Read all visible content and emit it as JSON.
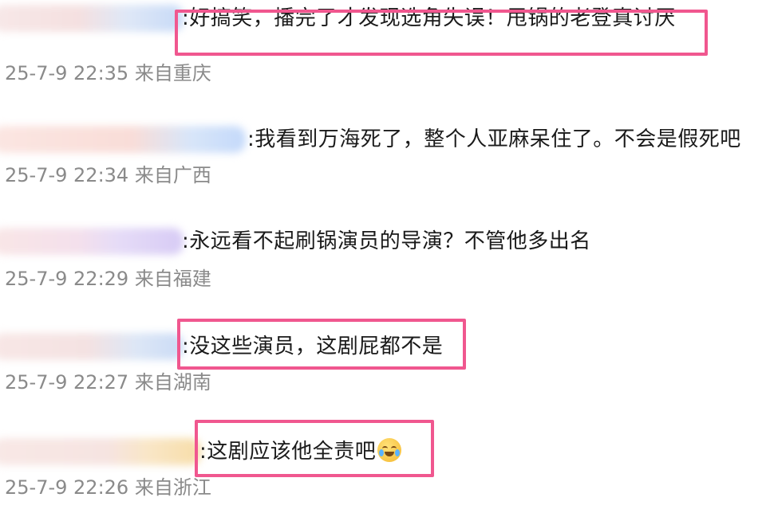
{
  "comments": [
    {
      "text": ":好搞笑，播完了才发现选角失误！甩锅的老登真讨厌",
      "meta": "25-7-9 22:35 来自重庆",
      "highlighted": true
    },
    {
      "text": ":我看到万海死了，整个人亚麻呆住了。不会是假死吧",
      "meta": "25-7-9 22:34 来自广西",
      "highlighted": false
    },
    {
      "text": ":永远看不起刷锅演员的导演？不管他多出名",
      "meta": "25-7-9 22:29 来自福建",
      "highlighted": false
    },
    {
      "text": ":没这些演员，这剧屁都不是",
      "meta": "25-7-9 22:27 来自湖南",
      "highlighted": true
    },
    {
      "text": ":这剧应该他全责吧",
      "meta": "25-7-9 22:26 来自浙江",
      "highlighted": true,
      "emoji": "laughing-crying-emoji"
    }
  ],
  "colors": {
    "highlight_border": "#f0578f",
    "meta_text": "#8a8a8a",
    "comment_text": "#1a1a1a"
  }
}
